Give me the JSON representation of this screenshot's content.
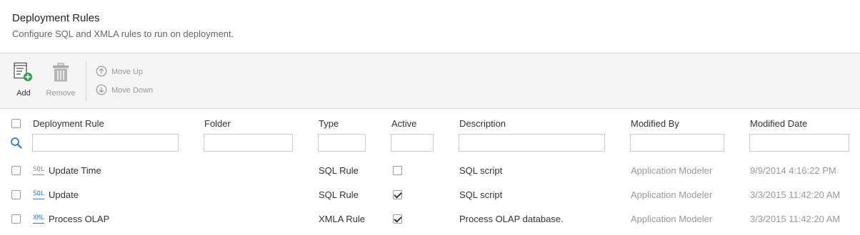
{
  "header": {
    "title": "Deployment Rules",
    "subtitle": "Configure SQL and XMLA rules to run on deployment."
  },
  "toolbar": {
    "add_label": "Add",
    "remove_label": "Remove",
    "move_up_label": "Move Up",
    "move_down_label": "Move Down"
  },
  "grid": {
    "columns": {
      "rule": "Deployment Rule",
      "folder": "Folder",
      "type": "Type",
      "active": "Active",
      "description": "Description",
      "modified_by": "Modified By",
      "modified_date": "Modified Date"
    },
    "rows": [
      {
        "icon": "SQL",
        "name": "Update Time",
        "folder": "",
        "type": "SQL Rule",
        "active": false,
        "description": "SQL script",
        "modified_by": "Application Modeler",
        "modified_date": "9/9/2014 4:16:22 PM"
      },
      {
        "icon": "SQL",
        "name": "Update",
        "folder": "",
        "type": "SQL Rule",
        "active": true,
        "description": "SQL script",
        "modified_by": "Application Modeler",
        "modified_date": "3/3/2015 11:42:20 AM"
      },
      {
        "icon": "XML",
        "name": "Process OLAP",
        "folder": "",
        "type": "XMLA Rule",
        "active": true,
        "description": "Process OLAP database.",
        "modified_by": "Application Modeler",
        "modified_date": "3/3/2015 11:42:20 AM"
      }
    ]
  },
  "colors": {
    "accent_green": "#2e9e4f",
    "icon_blue": "#2b7bd8",
    "muted_text": "#999999"
  }
}
